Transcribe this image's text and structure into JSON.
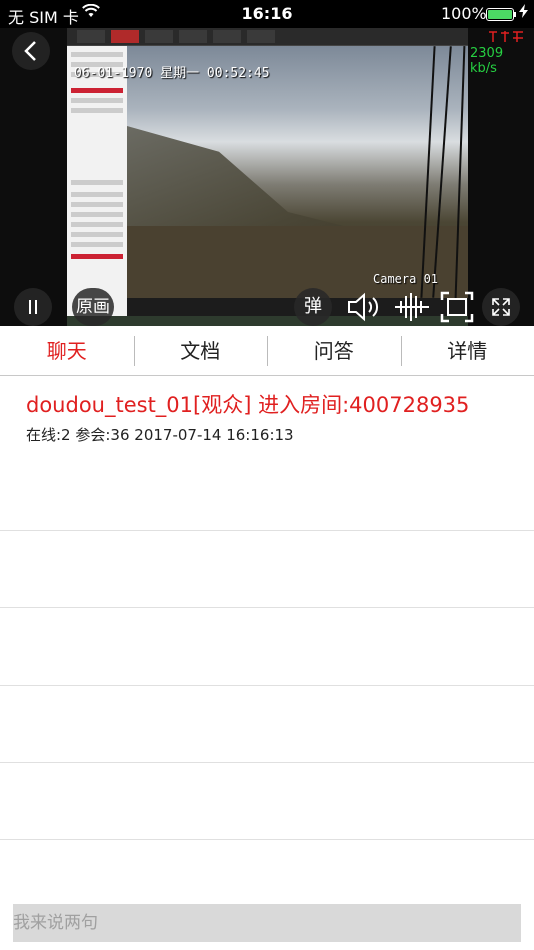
{
  "status_bar": {
    "carrier": "无 SIM 卡",
    "time": "16:16",
    "battery_percent": "100%",
    "battery_level": 1.0,
    "wifi_icon": "wifi-icon",
    "charging_icon": "bolt-icon"
  },
  "video": {
    "osd_date": "06-01-1970 星期一 00:52:45",
    "camera_label": "Camera 01",
    "speed": "2309 kb/s",
    "controls": {
      "pause_icon": "pause-icon",
      "quality_label": "原画",
      "danmaku_label": "弹",
      "volume_icon": "volume-icon",
      "audio_wave_icon": "audio-wave-icon",
      "screen_fit_icon": "screen-fit-icon",
      "fullscreen_icon": "fullscreen-icon"
    }
  },
  "tabs": [
    {
      "label": "聊天",
      "active": true
    },
    {
      "label": "文档",
      "active": false
    },
    {
      "label": "问答",
      "active": false
    },
    {
      "label": "详情",
      "active": false
    }
  ],
  "chat": {
    "message_title": "doudou_test_01[观众] 进入房间:400728935",
    "message_sub": "在线:2 参会:36 2017-07-14 16:16:13"
  },
  "input": {
    "placeholder": "我来说两句"
  },
  "colors": {
    "accent": "#e02020",
    "speed_green": "#26d042",
    "input_bg": "#d9d9d9"
  }
}
